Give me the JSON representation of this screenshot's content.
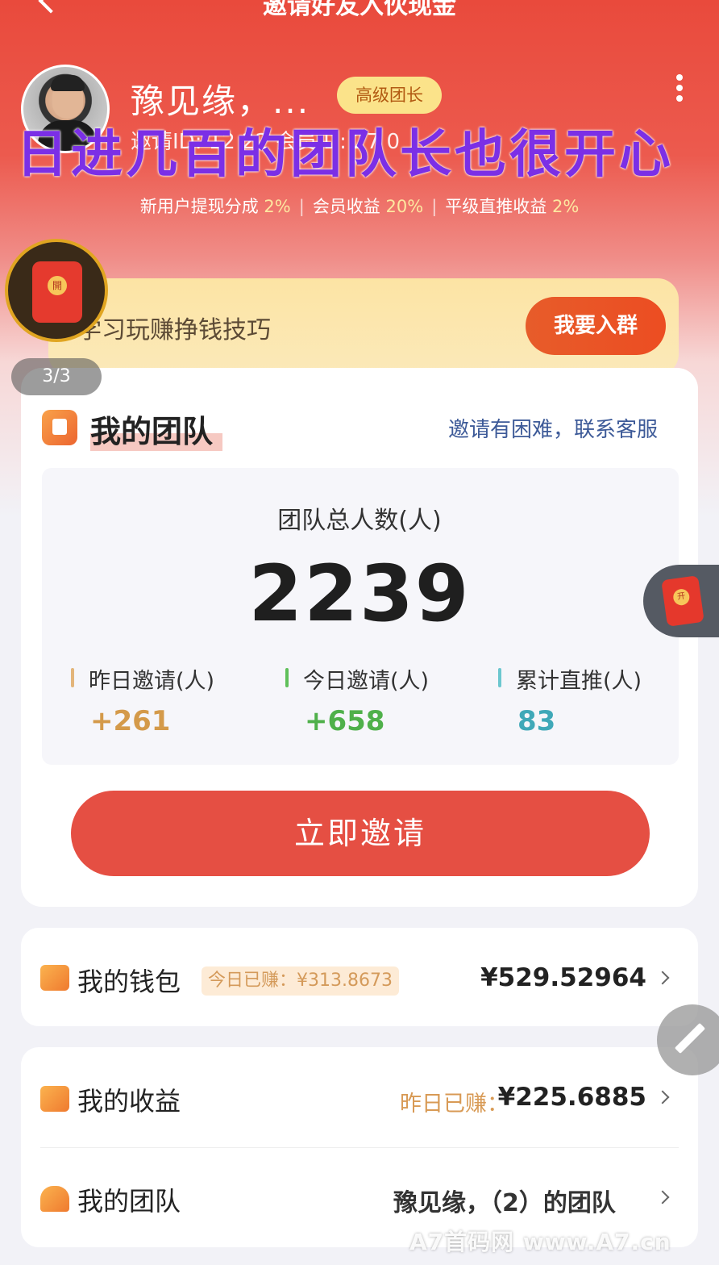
{
  "header": {
    "title": "邀请好友入伙现金",
    "username": "豫见缘，...",
    "level_badge": "高级团长",
    "ids_line": "邀请ID:  12 22  会员ID:  27 0",
    "overlay_banner": "日进几百的团队长也很开心",
    "rates": {
      "item1_label": "新用户提现分成",
      "item1_pct": "2%",
      "item2_label": "会员收益",
      "item2_pct": "20%",
      "item3_label": "平级直推收益",
      "item3_pct": "2%",
      "separator": "|"
    }
  },
  "group_banner": {
    "text": "学习玩赚挣钱技巧",
    "button": "我要入群",
    "redpacket_glyph": "開",
    "page_indicator": "3/3"
  },
  "team_card": {
    "title": "我的团队",
    "contact": "邀请有困难，联系客服",
    "total_label": "团队总人数(人)",
    "total_value": "2239",
    "stats": [
      {
        "label": "昨日邀请(人)",
        "value": "+261",
        "color": "#d49a4a"
      },
      {
        "label": "今日邀请(人)",
        "value": "+658",
        "color": "#4fb04a"
      },
      {
        "label": "累计直推(人)",
        "value": "83",
        "color": "#3fa8b8"
      }
    ],
    "invite_button": "立即邀请",
    "side_redpacket_glyph": "开"
  },
  "wallet": {
    "label": "我的钱包",
    "today_pill": "今日已赚：¥313.8673",
    "value": "¥529.52964"
  },
  "income": {
    "label": "我的收益",
    "yesterday_label": "昨日已赚：",
    "yesterday_value": "¥225.6885"
  },
  "team_row": {
    "label": "我的团队",
    "value": "豫见缘，（2）的团队"
  },
  "watermark": "A7首码网    www.A7.cn",
  "colors": {
    "brand_red": "#e54f43",
    "badge_yellow": "#fbe38a",
    "overlay_purple": "#7b2fe6"
  }
}
